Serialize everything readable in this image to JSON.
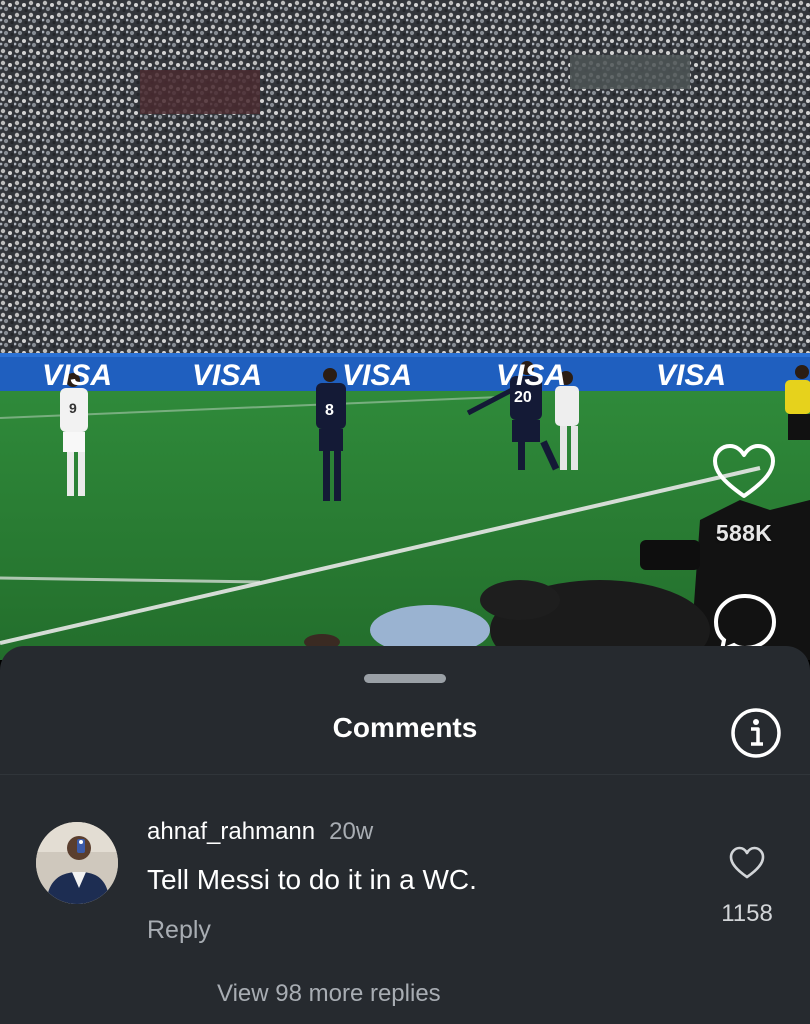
{
  "video": {
    "ad_board_text": "VISA",
    "player_numbers": [
      "9",
      "8",
      "20"
    ]
  },
  "reel_actions": {
    "like_count": "588K",
    "like_icon": "heart-outline-icon",
    "comment_icon": "comment-bubble-icon"
  },
  "comments_sheet": {
    "title": "Comments",
    "info_icon": "info-icon",
    "comment": {
      "username": "ahnaf_rahmann",
      "time": "20w",
      "text": "Tell Messi to do it in a WC.",
      "reply_label": "Reply",
      "like_count": "1158"
    },
    "view_replies_label": "View 98 more replies"
  },
  "colors": {
    "sheet_bg": "#262a2f",
    "text_primary": "#ffffff",
    "text_secondary": "#a8adb3",
    "ad_board_blue": "#1f5fbf"
  }
}
